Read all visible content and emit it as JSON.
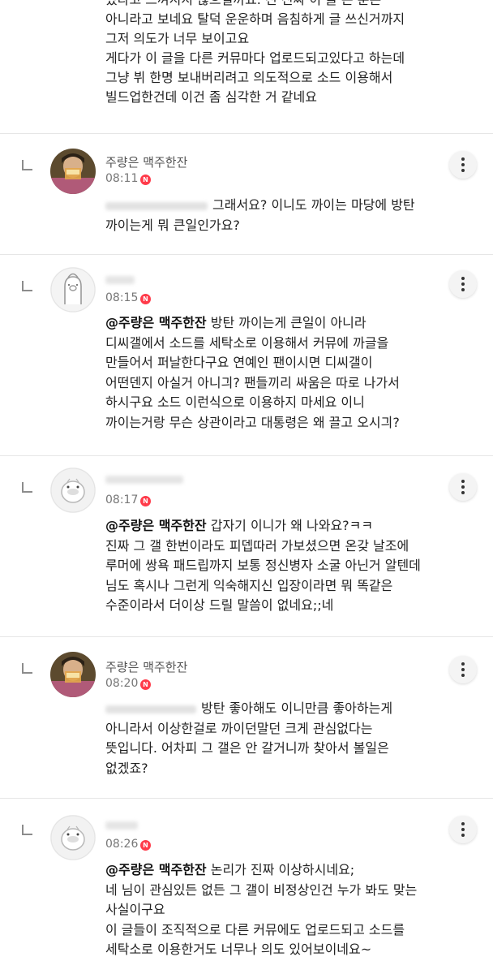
{
  "top_block": {
    "lines": [
      "있다고 느껴지지 않으실까요. 진 진짜 이 글 쓴 분은",
      "아니라고 보네요 탈덕 운운하며 음침하게 글 쓰신거까지",
      "그저 의도가 너무 보이고요",
      "게다가 이 글을 다른 커뮤마다 업로드되고있다고 하는데",
      "그냥 뷔 한명 보내버리려고 의도적으로 소드 이용해서",
      "빌드업한건데 이건 좀 심각한 거 같네요"
    ]
  },
  "comments": [
    {
      "nickname": "주량은 맥주한잔",
      "time": "08:11",
      "badge": "N",
      "mention": "",
      "lines": [
        "그래서요? 이니도 까이는 마당에 방탄",
        "까이는게 뭐 큰일인가요?"
      ]
    },
    {
      "nickname": "",
      "time": "08:15",
      "badge": "N",
      "mention": "@주량은 맥주한잔",
      "lines": [
        "방탄 까이는게 큰일이 아니라",
        "디씨갤에서 소드를 세탁소로 이용해서 커뮤에 까글을",
        "만들어서 퍼날한다구요 연예인 팬이시면 디씨갤이",
        "어떤덴지 아실거 아니긔? 팬들끼리 싸움은 따로 나가서",
        "하시구요 소드 이런식으로 이용하지 마세요 이니",
        "까이는거랑 무슨 상관이라고 대통령은 왜 끌고 오시긔?"
      ]
    },
    {
      "nickname": "",
      "time": "08:17",
      "badge": "N",
      "mention": "@주량은 맥주한잔",
      "lines": [
        "갑자기 이니가 왜 나와요?ㅋㅋ",
        "진짜 그 갤 한번이라도 피뎁따러 가보셨으면 온갖 날조에",
        "루머에 쌍욕 패드립까지 보통 정신병자 소굴 아닌거 알텐데",
        "님도 혹시나 그런게 익숙해지신 입장이라면 뭐 똑같은",
        "수준이라서 더이상 드릴 말씀이 없네요;;네"
      ]
    },
    {
      "nickname": "주량은 맥주한잔",
      "time": "08:20",
      "badge": "N",
      "mention": "",
      "lines": [
        "방탄 좋아해도 이니만큼 좋아하는게",
        "아니라서 이상한걸로 까이던말던 크게 관심없다는",
        "뜻입니다. 어차피 그 갤은 안 갈거니까 찾아서 볼일은",
        "없겠죠?"
      ]
    },
    {
      "nickname": "",
      "time": "08:26",
      "badge": "N",
      "mention": "@주량은 맥주한잔",
      "lines": [
        "논리가 진짜 이상하시네요;",
        "네 님이 관심있든 없든 그 갤이 비정상인건 누가 봐도 맞는",
        "사실이구요",
        "이 글들이 조직적으로 다른 커뮤에도 업로드되고 소드를",
        "세탁소로 이용한거도 너무나 의도 있어보이네요~"
      ]
    }
  ],
  "colors": {
    "new_badge": "#ff3b4a",
    "divider": "#e6e6e6",
    "reply_mark": "#8c8c8c"
  },
  "icons": {
    "more": "vertical-ellipsis",
    "reply": "reply-corner-arrow"
  }
}
